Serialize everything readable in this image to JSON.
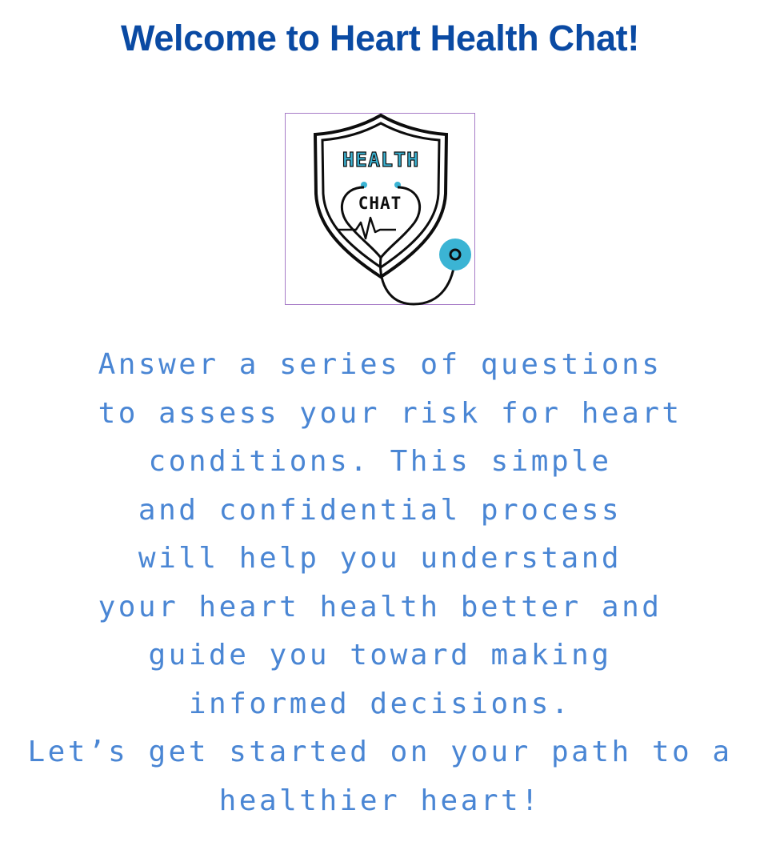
{
  "colors": {
    "title": "#0a4aa3",
    "text": "#4a86d4",
    "frame": "#a77cc7",
    "accent": "#3bb4d4",
    "ink": "#0d0d0d"
  },
  "header": {
    "title": "Welcome to Heart Health Chat!"
  },
  "logo": {
    "icon": "heart-stethoscope-shield-icon",
    "top_text": "HEALTH",
    "chat_text": "CHAT"
  },
  "intro": {
    "lines": [
      "Answer a series of questions",
      " to assess your risk for heart",
      "conditions. This simple",
      "and confidential process",
      "will help you understand",
      "your heart health better and",
      "guide you toward making",
      "informed decisions.",
      "Let’s get started on your path to a",
      "healthier heart!"
    ]
  }
}
